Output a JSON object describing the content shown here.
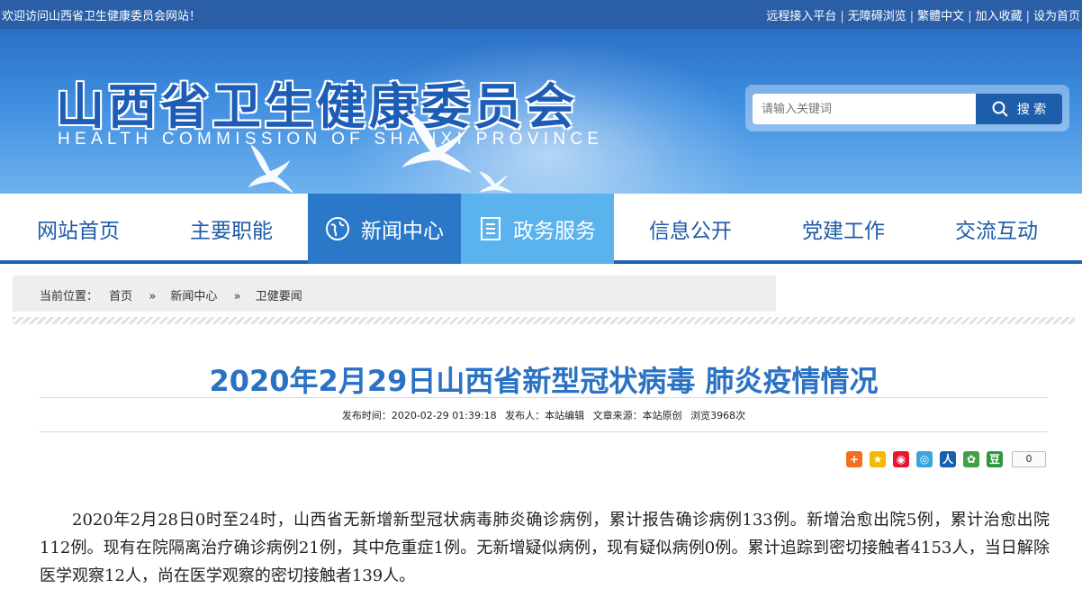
{
  "topbar": {
    "welcome": "欢迎访问山西省卫生健康委员会网站！",
    "links": [
      "远程接入平台",
      "无障碍浏览",
      "繁體中文",
      "加入收藏",
      "设为首页"
    ]
  },
  "banner": {
    "title": "山西省卫生健康委员会",
    "subtitle": "HEALTH COMMISSION OF SHANXI PROVINCE"
  },
  "search": {
    "placeholder": "请输入关键词",
    "button_label": "搜 索"
  },
  "nav": {
    "items": [
      {
        "label": "网站首页",
        "icon": ""
      },
      {
        "label": "主要职能",
        "icon": ""
      },
      {
        "label": "新闻中心",
        "icon": "globe-icon"
      },
      {
        "label": "政务服务",
        "icon": "document-icon"
      },
      {
        "label": "信息公开",
        "icon": ""
      },
      {
        "label": "党建工作",
        "icon": ""
      },
      {
        "label": "交流互动",
        "icon": ""
      }
    ]
  },
  "breadcrumb": {
    "prefix": "当前位置：",
    "items": [
      "首页",
      "新闻中心",
      "卫健要闻"
    ],
    "separator": "»"
  },
  "article": {
    "title": "2020年2月29日山西省新型冠状病毒 肺炎疫情情况",
    "meta": {
      "publish_time": "发布时间：2020-02-29 01:39:18",
      "publisher": "发布人：本站编辑",
      "source": "文章来源：本站原创",
      "views": "浏览3968次"
    },
    "share_count": "0",
    "body": "2020年2月28日0时至24时，山西省无新增新型冠状病毒肺炎确诊病例，累计报告确诊病例133例。新增治愈出院5例，累计治愈出院112例。现有在院隔离治疗确诊病例21例，其中危重症1例。无新增疑似病例，现有疑似病例0例。累计追踪到密切接触者4153人，当日解除医学观察12人，尚在医学观察的密切接触者139人。"
  },
  "share_icons": [
    {
      "name": "share-plus-icon",
      "color": "#f26d21",
      "glyph": "+"
    },
    {
      "name": "qzone-icon",
      "color": "#f5b800",
      "glyph": "★"
    },
    {
      "name": "weibo-icon",
      "color": "#e6162d",
      "glyph": "◉"
    },
    {
      "name": "tencent-weibo-icon",
      "color": "#3aa3dc",
      "glyph": "◎"
    },
    {
      "name": "renren-icon",
      "color": "#1660ae",
      "glyph": "人"
    },
    {
      "name": "kaixin-icon",
      "color": "#43a047",
      "glyph": "✿"
    },
    {
      "name": "douban-icon",
      "color": "#2e963d",
      "glyph": "豆"
    }
  ],
  "colors": {
    "topbar": "#2a5fa8",
    "nav_text": "#1e5aa8",
    "nav_active": "#2c78c8",
    "nav_light": "#5bb3ee",
    "title": "#2a72c4"
  }
}
